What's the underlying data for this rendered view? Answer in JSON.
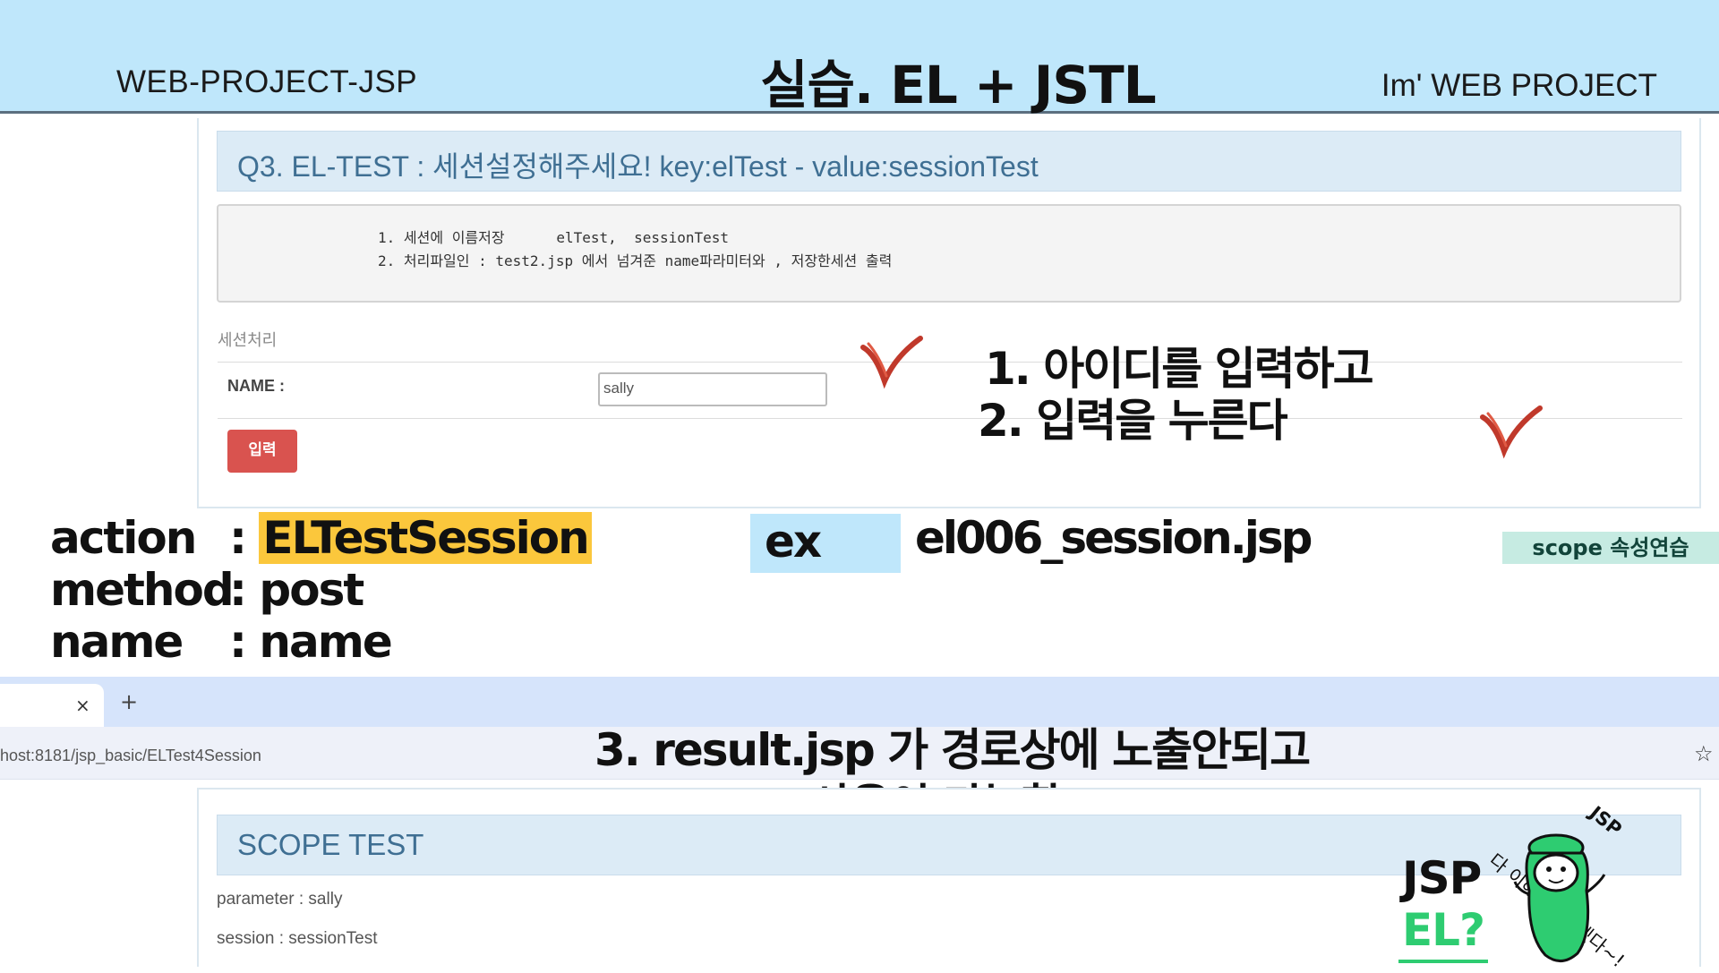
{
  "header": {
    "left": "WEB-PROJECT-JSP",
    "center": "실습. EL + JSTL",
    "right": "Im'  WEB PROJECT"
  },
  "q3": {
    "title": "Q3. EL-TEST : 세션설정해주세요! key:elTest - value:sessionTest",
    "instructions": [
      "1. 세션에 이름저장      elTest,  sessionTest",
      "2. 처리파일인 : test2.jsp 에서 넘겨준 name파라미터와 , 저장한세션 출력"
    ],
    "section_label": "세션처리",
    "name_label": "NAME :",
    "name_value": "sally",
    "submit_label": "입력"
  },
  "steps": {
    "step1": "1. 아이디를 입력하고",
    "step2": "2. 입력을 누른다",
    "step3_line1": "3.  result.jsp 가 경로상에 노출안되고",
    "step3_line2": "param 사용이 가능함."
  },
  "form_spec": {
    "action_key": "action",
    "action_value": "ELTestSession",
    "method_key": "method",
    "method_value": "post",
    "name_key": "name",
    "name_value": "name",
    "separator": ":"
  },
  "example": {
    "label": "ex",
    "file": "el006_session.jsp"
  },
  "scope_tag": "scope 속성연습",
  "browser": {
    "tab_close": "×",
    "tab_new": "+",
    "url": "host:8181/jsp_basic/ELTest4Session",
    "star": "☆"
  },
  "result": {
    "title": "SCOPE TEST",
    "parameter_line": "parameter : sally",
    "session_line": "session : sessionTest"
  },
  "mascot": {
    "jsp": "JSP",
    "el": "EL?",
    "speech": "다 이해해버리겠다~!",
    "speech_tag": "JSP"
  },
  "colors": {
    "header_bg": "#bfe7fb",
    "highlight": "#fbc73c",
    "button": "#d9534f",
    "check": "#c0392b",
    "mascot_green": "#2ecc71"
  }
}
